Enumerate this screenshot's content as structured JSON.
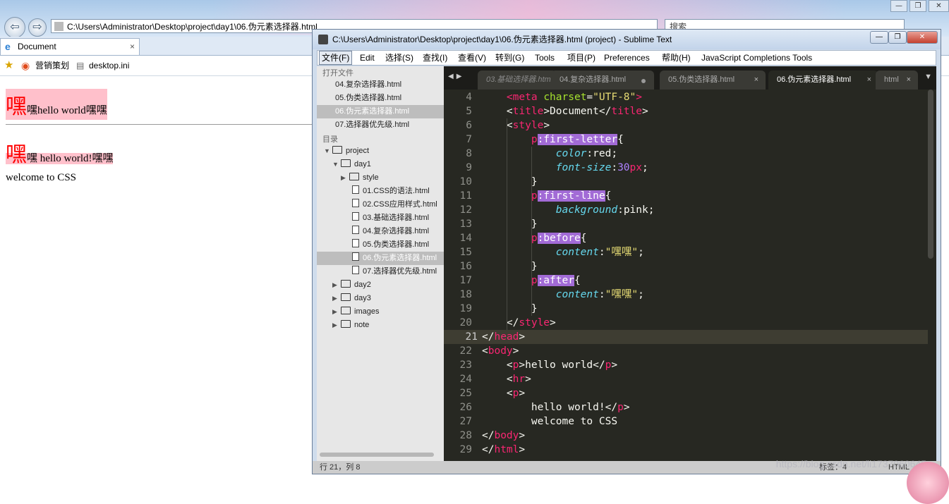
{
  "browser": {
    "address": "C:\\Users\\Administrator\\Desktop\\project\\day1\\06.伪元素选择器.html",
    "search_placeholder": "搜索",
    "tab_title": "Document",
    "tab_close": "×",
    "favorites": [
      "营销策划",
      "desktop.ini"
    ],
    "window_buttons": [
      "—",
      "❐",
      "✕"
    ]
  },
  "page": {
    "p1_first_letter": "嘿",
    "p1_rest": "嘿hello world嘿嘿",
    "p2_first_letter": "嘿",
    "p2_rest": "嘿 hello world!嘿嘿",
    "p3": "welcome to CSS"
  },
  "sublime": {
    "title": "C:\\Users\\Administrator\\Desktop\\project\\day1\\06.伪元素选择器.html (project) - Sublime Text",
    "menu": [
      "文件(F)",
      "Edit",
      "选择(S)",
      "查找(I)",
      "查看(V)",
      "转到(G)",
      "Tools",
      "项目(P)",
      "Preferences",
      "帮助(H)",
      "JavaScript Completions Tools"
    ],
    "sidebar": {
      "open_files_header": "打开文件",
      "open_files": [
        "04.复杂选择器.html",
        "05.伪类选择器.html",
        "06.伪元素选择器.html",
        "07.选择器优先级.html"
      ],
      "folders_header": "目录",
      "tree": [
        {
          "label": "project",
          "kind": "folder-open",
          "level": 0
        },
        {
          "label": "day1",
          "kind": "folder-open",
          "level": 1
        },
        {
          "label": "style",
          "kind": "folder",
          "level": 2
        },
        {
          "label": "01.CSS的语法.html",
          "kind": "file",
          "level": 3
        },
        {
          "label": "02.CSS应用样式.html",
          "kind": "file",
          "level": 3
        },
        {
          "label": "03.基础选择器.html",
          "kind": "file",
          "level": 3
        },
        {
          "label": "04.复杂选择器.html",
          "kind": "file",
          "level": 3
        },
        {
          "label": "05.伪类选择器.html",
          "kind": "file",
          "level": 3
        },
        {
          "label": "06.伪元素选择器.html",
          "kind": "file",
          "level": 3
        },
        {
          "label": "07.选择器优先级.html",
          "kind": "file",
          "level": 3
        },
        {
          "label": "day2",
          "kind": "folder",
          "level": 1
        },
        {
          "label": "day3",
          "kind": "folder",
          "level": 1
        },
        {
          "label": "images",
          "kind": "folder",
          "level": 1
        },
        {
          "label": "note",
          "kind": "folder",
          "level": 1
        }
      ]
    },
    "tabs": [
      {
        "label": "03.基础选择器.html",
        "close": ""
      },
      {
        "label": "04.复杂选择器.html",
        "close": "●"
      },
      {
        "label": "05.伪类选择器.html",
        "close": "×"
      },
      {
        "label": "06.伪元素选择器.html",
        "close": "×"
      },
      {
        "label": "html",
        "close": "×"
      }
    ],
    "line_numbers": [
      "4",
      "5",
      "6",
      "7",
      "8",
      "9",
      "10",
      "11",
      "12",
      "13",
      "14",
      "15",
      "16",
      "17",
      "18",
      "19",
      "20",
      "21",
      "22",
      "23",
      "24",
      "25",
      "26",
      "27",
      "28",
      "29"
    ],
    "status": {
      "position": "行 21，列 8",
      "tab_size": "标签：4",
      "syntax": "HTML"
    },
    "watermark": "https://blog.csdn.net/li1737060645"
  }
}
